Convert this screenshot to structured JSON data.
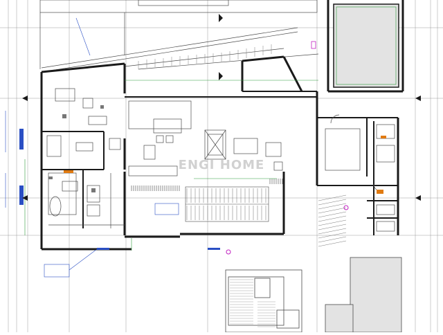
{
  "drawing": {
    "watermark_text": "ENGI HOME",
    "colors": {
      "paper": "#ffffff",
      "wall": "#1a1a1a",
      "line": "#4a4a4a",
      "thin": "#9a9a9a",
      "dim_green": "#2e9a3a",
      "note_blue": "#2a4fc4",
      "accent_magenta": "#c020c0",
      "accent_orange": "#e07a10",
      "pool_fill": "#e3e3e3",
      "watermark": "#c9c9c9"
    }
  }
}
